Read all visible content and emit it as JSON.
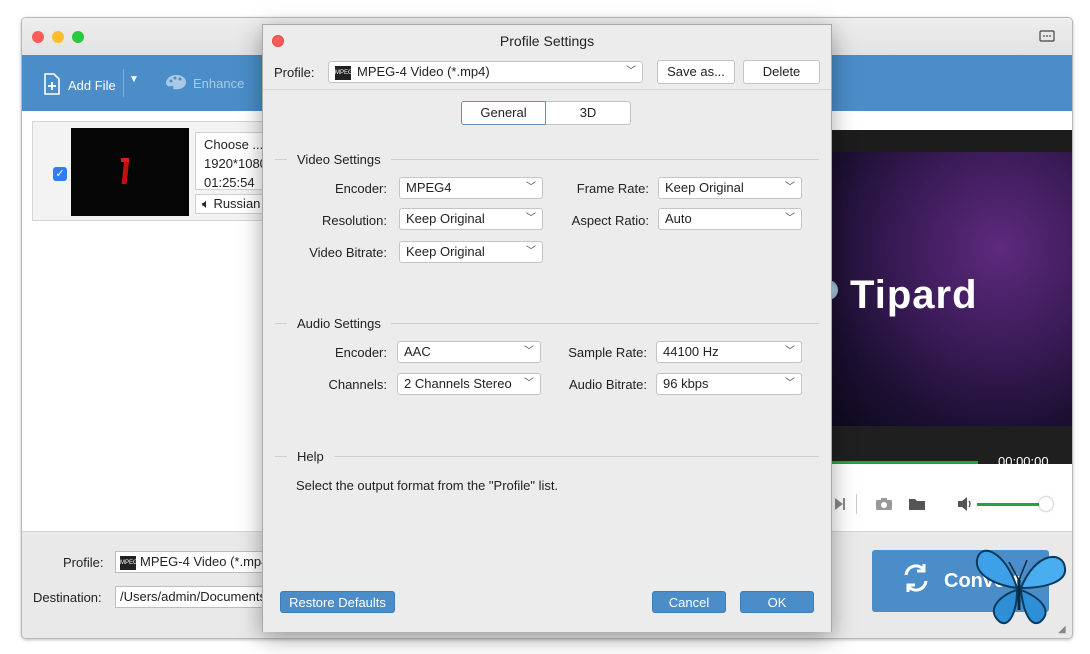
{
  "main": {
    "toolbar": {
      "add_file": "Add File",
      "enhance": "Enhance"
    },
    "file": {
      "name": "Choose ...",
      "resolution": "1920*1080",
      "duration": "01:25:54",
      "audio": "Russian"
    },
    "preview": {
      "brand": "Tipard",
      "time": "00:00:00",
      "progress": 0.0
    },
    "bottom": {
      "profile_label": "Profile:",
      "profile_value": "MPEG-4 Video (*.mp4)",
      "destination_label": "Destination:",
      "destination_value": "/Users/admin/Documents",
      "convert_label": "Convert"
    }
  },
  "dialog": {
    "title": "Profile Settings",
    "profile_label": "Profile:",
    "profile_value": "MPEG-4 Video (*.mp4)",
    "save_as": "Save as...",
    "delete": "Delete",
    "tabs": [
      "General",
      "3D"
    ],
    "video": {
      "title": "Video Settings",
      "encoder_label": "Encoder:",
      "encoder": "MPEG4",
      "frame_rate_label": "Frame Rate:",
      "frame_rate": "Keep Original",
      "resolution_label": "Resolution:",
      "resolution": "Keep Original",
      "aspect_label": "Aspect Ratio:",
      "aspect": "Auto",
      "bitrate_label": "Video Bitrate:",
      "bitrate": "Keep Original"
    },
    "audio": {
      "title": "Audio Settings",
      "encoder_label": "Encoder:",
      "encoder": "AAC",
      "sample_label": "Sample Rate:",
      "sample": "44100 Hz",
      "channels_label": "Channels:",
      "channels": "2 Channels Stereo",
      "bitrate_label": "Audio Bitrate:",
      "bitrate": "96 kbps"
    },
    "help": {
      "title": "Help",
      "text": "Select the output format from the \"Profile\" list."
    },
    "restore": "Restore Defaults",
    "cancel": "Cancel",
    "ok": "OK"
  },
  "colors": {
    "accent": "#4a8dc8",
    "progress": "#23a243"
  }
}
